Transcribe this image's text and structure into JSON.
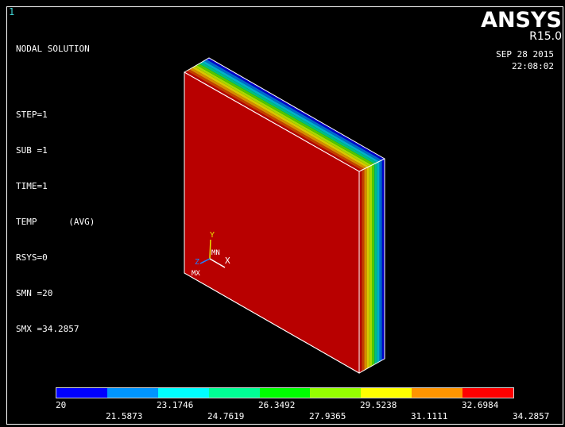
{
  "window_number": "1",
  "result": {
    "title": "NODAL SOLUTION",
    "lines": [
      "STEP=1",
      "SUB =1",
      "TIME=1",
      "TEMP      (AVG)",
      "RSYS=0",
      "SMN =20",
      "SMX =34.2857"
    ]
  },
  "brand": {
    "name": "ANSYS",
    "release": "R15.0",
    "date": "SEP 28 2015",
    "time": "22:08:02"
  },
  "triad": {
    "y": "Y",
    "x": "X",
    "z": "Z",
    "mn": "MN",
    "mx": "MX"
  },
  "legend": {
    "colors": [
      "#0000ff",
      "#0095ff",
      "#00ffff",
      "#00ff95",
      "#00ff00",
      "#95ff00",
      "#ffff00",
      "#ff9500",
      "#ff0000"
    ],
    "labels_top": [
      "20",
      "23.1746",
      "26.3492",
      "29.5238",
      "32.6984"
    ],
    "labels_bottom": [
      "21.5873",
      "24.7619",
      "27.9365",
      "31.1111",
      "34.2857"
    ]
  },
  "model_colors": {
    "front": "#b80000",
    "edge": "#ffffff",
    "band_stack": [
      "#b80000",
      "#c63d00",
      "#d88a00",
      "#d8c800",
      "#a8d800",
      "#50c800",
      "#00c080",
      "#00b0c8",
      "#0068d0",
      "#0000c8"
    ]
  }
}
